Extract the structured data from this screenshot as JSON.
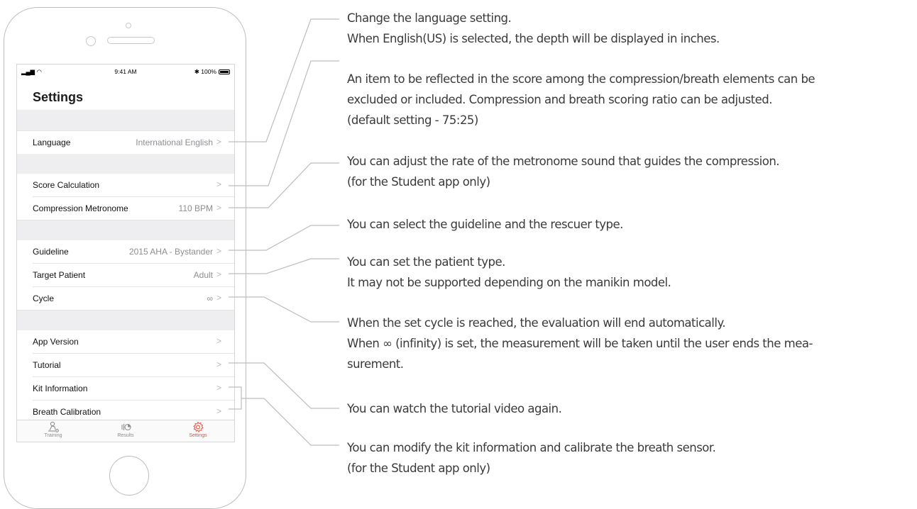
{
  "statusbar": {
    "signal": "▂▄▆ ◠",
    "time": "9:41 AM",
    "battery": "✱ 100%"
  },
  "settings": {
    "title": "Settings",
    "language": {
      "label": "Language",
      "value": "International English"
    },
    "score": {
      "label": "Score Calculation",
      "value": ""
    },
    "metronome": {
      "label": "Compression Metronome",
      "value": "110 BPM"
    },
    "guideline": {
      "label": "Guideline",
      "value": "2015 AHA - Bystander"
    },
    "patient": {
      "label": "Target Patient",
      "value": "Adult"
    },
    "cycle": {
      "label": "Cycle",
      "value": "∞"
    },
    "app_version": {
      "label": "App Version"
    },
    "tutorial": {
      "label": "Tutorial"
    },
    "kit": {
      "label": "Kit Information"
    },
    "breath": {
      "label": "Breath Calibration"
    },
    "chevron": ">"
  },
  "tabbar": {
    "training": "Training",
    "results": "Results",
    "settings": "Settings",
    "active": "settings",
    "active_color": "#e8503a"
  },
  "annotations": [
    [
      "Change the language setting.",
      "When English(US) is selected, the depth will be displayed in inches."
    ],
    [
      "An item to be reflected in the score among the compression/breath elements can be",
      "excluded or included. Compression and breath scoring ratio can be adjusted.",
      "(default setting - 75:25)"
    ],
    [
      "You can adjust the rate of the metronome sound that guides the compression.",
      "(for the Student app only)"
    ],
    [
      "You can select the guideline and the rescuer type."
    ],
    [
      "You can set the patient type.",
      "It may not be supported depending on the manikin model."
    ],
    [
      "When the set cycle is reached, the evaluation will end automatically.",
      "When ∞ (infinity) is set, the measurement will be taken until the user ends the mea-",
      "surement."
    ],
    [
      "You can watch the tutorial video again."
    ],
    [
      "You can modify the kit information and calibrate the breath sensor.",
      "(for the Student app only)"
    ]
  ]
}
